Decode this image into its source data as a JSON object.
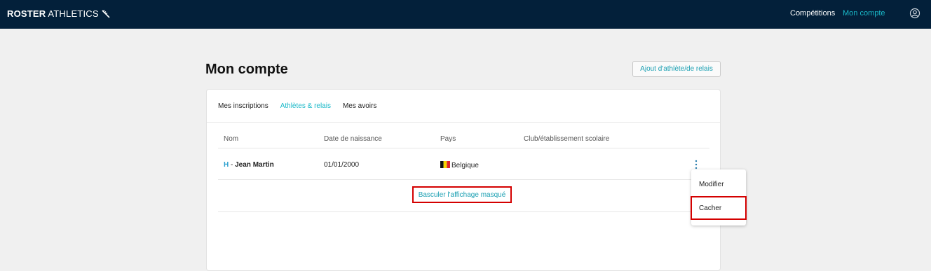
{
  "brand": {
    "bold": "ROSTER",
    "light": "ATHLETICS"
  },
  "nav": {
    "competitions": "Compétitions",
    "account": "Mon compte"
  },
  "page": {
    "title": "Mon compte",
    "add_button": "Ajout d'athlète/de relais"
  },
  "tabs": [
    "Mes inscriptions",
    "Athlètes & relais",
    "Mes avoirs"
  ],
  "table": {
    "headers": [
      "Nom",
      "Date de naissance",
      "Pays",
      "Club/établissement scolaire"
    ],
    "rows": [
      {
        "gender": "H",
        "separator": " - ",
        "name": "Jean Martin",
        "birthdate": "01/01/2000",
        "country": "Belgique",
        "club": ""
      }
    ]
  },
  "toggle_hidden": "Basculer l'affichage masqué",
  "row_menu": {
    "items": [
      "Modifier",
      "Cacher"
    ]
  },
  "colors": {
    "header_bg": "#03203a",
    "accent": "#19b8c8",
    "highlight": "#d40000"
  }
}
